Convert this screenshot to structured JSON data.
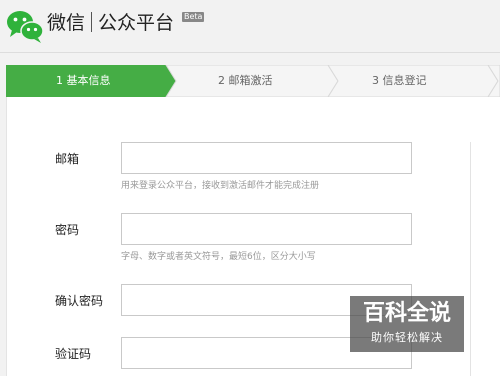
{
  "header": {
    "brand_name": "微信",
    "brand_product": "公众平台",
    "beta": "Beta"
  },
  "steps": [
    {
      "label": "1 基本信息",
      "active": true
    },
    {
      "label": "2 邮箱激活",
      "active": false
    },
    {
      "label": "3 信息登记",
      "active": false
    }
  ],
  "form": {
    "email_label": "邮箱",
    "email_hint": "用来登录公众平台，接收到激活邮件才能完成注册",
    "password_label": "密码",
    "password_hint": "字母、数字或者英文符号，最短6位，区分大小写",
    "confirm_label": "确认密码",
    "captcha_label": "验证码"
  },
  "watermark": {
    "title": "百科全说",
    "subtitle": "助你轻松解决"
  },
  "colors": {
    "active_step": "#45ad45",
    "inactive_step": "#f5f5f5"
  }
}
